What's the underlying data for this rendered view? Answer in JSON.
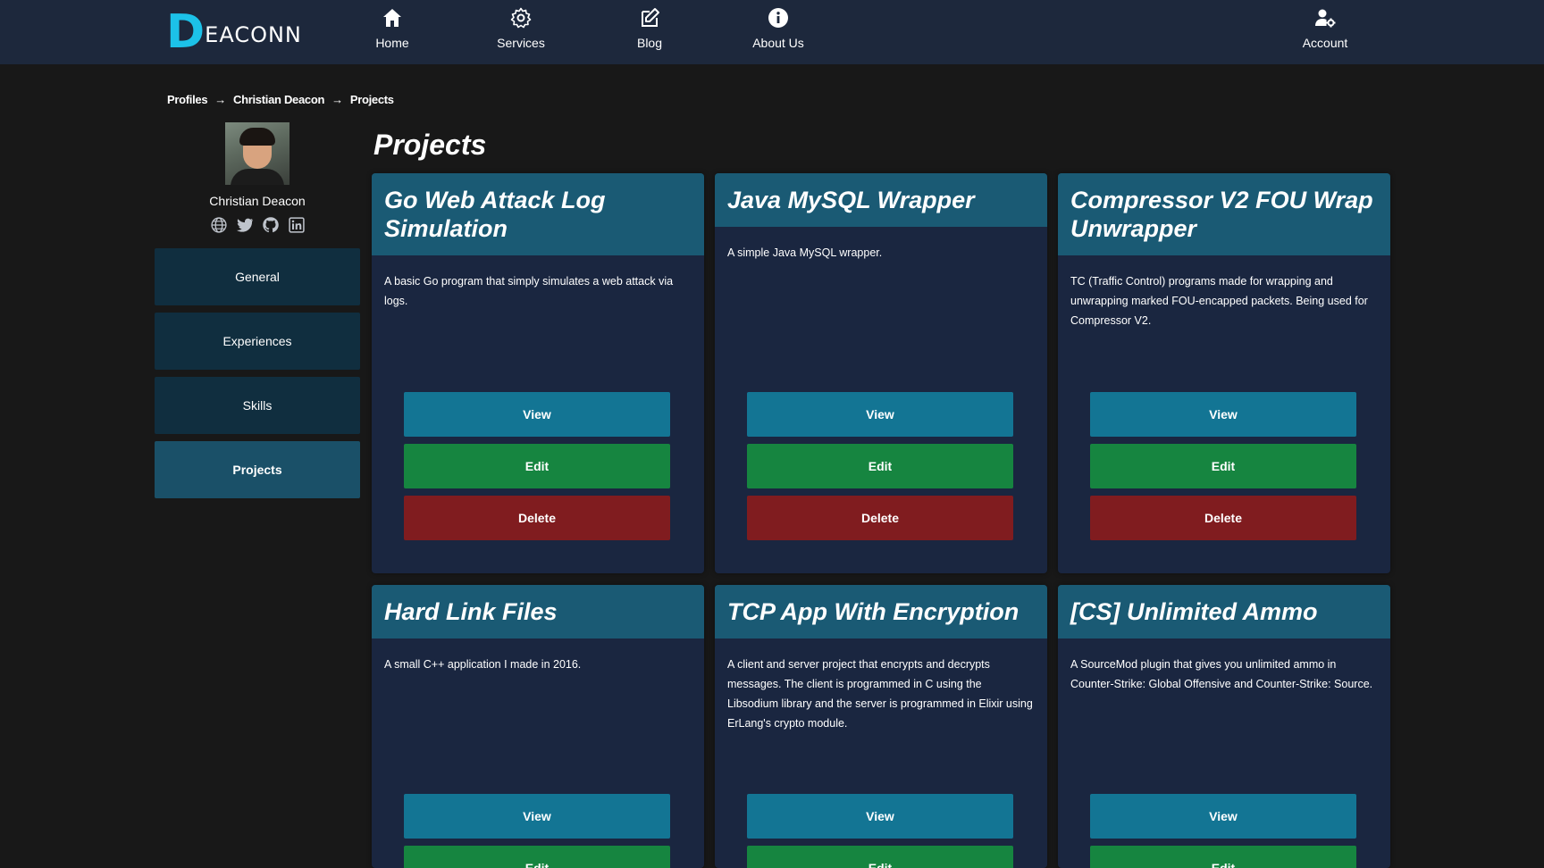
{
  "brand": {
    "logo_letter": "D",
    "logo_text": "EACONN"
  },
  "nav": {
    "home": "Home",
    "services": "Services",
    "blog": "Blog",
    "about": "About Us",
    "account": "Account"
  },
  "breadcrumb": {
    "items": [
      "Profiles",
      "Christian Deacon",
      "Projects"
    ],
    "separator": "→"
  },
  "profile": {
    "name": "Christian Deacon"
  },
  "sidebar": {
    "items": [
      "General",
      "Experiences",
      "Skills",
      "Projects"
    ],
    "active": "Projects"
  },
  "page": {
    "title": "Projects"
  },
  "buttons": {
    "view": "View",
    "edit": "Edit",
    "delete": "Delete"
  },
  "projects": [
    {
      "title": "Go Web Attack Log Simulation",
      "description": "A basic Go program that simply simulates a web attack via logs."
    },
    {
      "title": "Java MySQL Wrapper",
      "description": "A simple Java MySQL wrapper."
    },
    {
      "title": "Compressor V2 FOU Wrap Unwrapper",
      "description": "TC (Traffic Control) programs made for wrapping and unwrapping marked FOU-encapped packets. Being used for Compressor V2."
    },
    {
      "title": "Hard Link Files",
      "description": "A small C++ application I made in 2016."
    },
    {
      "title": "TCP App With Encryption",
      "description": "A client and server project that encrypts and decrypts messages. The client is programmed in C using the Libsodium library and the server is programmed in Elixir using ErLang's crypto module."
    },
    {
      "title": "[CS] Unlimited Ammo",
      "description": "A SourceMod plugin that gives you unlimited ammo in Counter-Strike: Global Offensive and Counter-Strike: Source."
    }
  ],
  "colors": {
    "header_bg": "#1d283c",
    "page_bg": "#181818",
    "card_bg": "#1a2640",
    "card_head": "#1a5a74",
    "view": "#137594",
    "edit": "#168540",
    "delete": "#801c1f",
    "accent": "#1cc1e8"
  }
}
